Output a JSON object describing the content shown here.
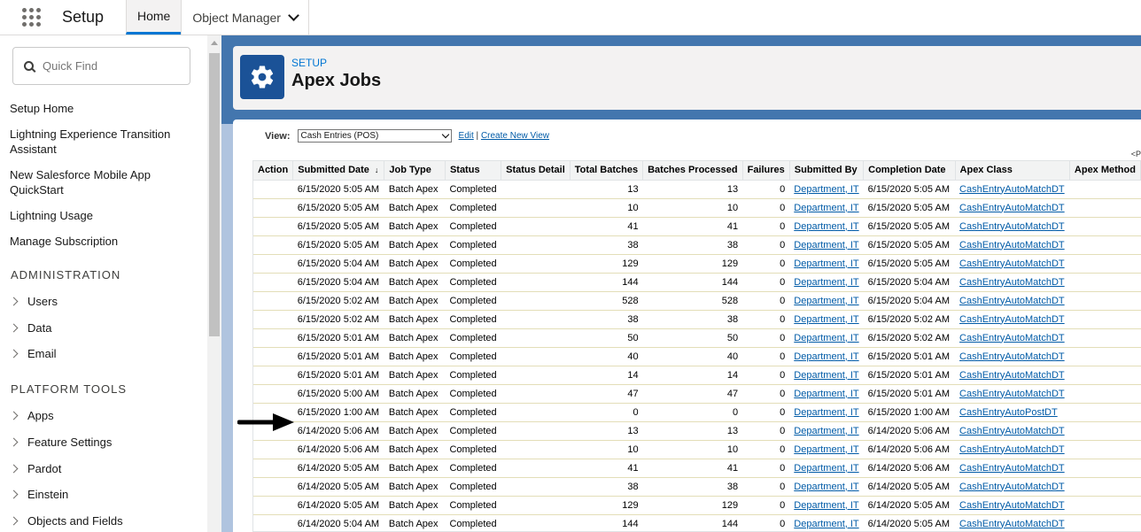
{
  "topbar": {
    "app_name": "Setup",
    "tabs": [
      {
        "label": "Home",
        "active": true
      },
      {
        "label": "Object Manager",
        "active": false
      }
    ]
  },
  "sidebar": {
    "quick_find_placeholder": "Quick Find",
    "links": [
      "Setup Home",
      "Lightning Experience Transition Assistant",
      "New Salesforce Mobile App QuickStart",
      "Lightning Usage",
      "Manage Subscription"
    ],
    "section_admin": "ADMINISTRATION",
    "admin_items": [
      "Users",
      "Data",
      "Email"
    ],
    "section_platform": "PLATFORM TOOLS",
    "platform_items": [
      "Apps",
      "Feature Settings",
      "Pardot",
      "Einstein",
      "Objects and Fields"
    ]
  },
  "header": {
    "eyebrow": "SETUP",
    "title": "Apex Jobs"
  },
  "view": {
    "label": "View:",
    "selected": "Cash Entries (POS)",
    "edit": "Edit",
    "separator": "|",
    "create": "Create New View",
    "pager_hint": "<P"
  },
  "table": {
    "columns": [
      "Action",
      "Submitted Date",
      "Job Type",
      "Status",
      "Status Detail",
      "Total Batches",
      "Batches Processed",
      "Failures",
      "Submitted By",
      "Completion Date",
      "Apex Class",
      "Apex Method"
    ],
    "sort_indicator": "↓",
    "rows": [
      [
        "",
        "6/15/2020 5:05 AM",
        "Batch Apex",
        "Completed",
        "",
        "13",
        "13",
        "0",
        "Department, IT",
        "6/15/2020 5:05 AM",
        "CashEntryAutoMatchDT",
        ""
      ],
      [
        "",
        "6/15/2020 5:05 AM",
        "Batch Apex",
        "Completed",
        "",
        "10",
        "10",
        "0",
        "Department, IT",
        "6/15/2020 5:05 AM",
        "CashEntryAutoMatchDT",
        ""
      ],
      [
        "",
        "6/15/2020 5:05 AM",
        "Batch Apex",
        "Completed",
        "",
        "41",
        "41",
        "0",
        "Department, IT",
        "6/15/2020 5:05 AM",
        "CashEntryAutoMatchDT",
        ""
      ],
      [
        "",
        "6/15/2020 5:05 AM",
        "Batch Apex",
        "Completed",
        "",
        "38",
        "38",
        "0",
        "Department, IT",
        "6/15/2020 5:05 AM",
        "CashEntryAutoMatchDT",
        ""
      ],
      [
        "",
        "6/15/2020 5:04 AM",
        "Batch Apex",
        "Completed",
        "",
        "129",
        "129",
        "0",
        "Department, IT",
        "6/15/2020 5:05 AM",
        "CashEntryAutoMatchDT",
        ""
      ],
      [
        "",
        "6/15/2020 5:04 AM",
        "Batch Apex",
        "Completed",
        "",
        "144",
        "144",
        "0",
        "Department, IT",
        "6/15/2020 5:04 AM",
        "CashEntryAutoMatchDT",
        ""
      ],
      [
        "",
        "6/15/2020 5:02 AM",
        "Batch Apex",
        "Completed",
        "",
        "528",
        "528",
        "0",
        "Department, IT",
        "6/15/2020 5:04 AM",
        "CashEntryAutoMatchDT",
        ""
      ],
      [
        "",
        "6/15/2020 5:02 AM",
        "Batch Apex",
        "Completed",
        "",
        "38",
        "38",
        "0",
        "Department, IT",
        "6/15/2020 5:02 AM",
        "CashEntryAutoMatchDT",
        ""
      ],
      [
        "",
        "6/15/2020 5:01 AM",
        "Batch Apex",
        "Completed",
        "",
        "50",
        "50",
        "0",
        "Department, IT",
        "6/15/2020 5:02 AM",
        "CashEntryAutoMatchDT",
        ""
      ],
      [
        "",
        "6/15/2020 5:01 AM",
        "Batch Apex",
        "Completed",
        "",
        "40",
        "40",
        "0",
        "Department, IT",
        "6/15/2020 5:01 AM",
        "CashEntryAutoMatchDT",
        ""
      ],
      [
        "",
        "6/15/2020 5:01 AM",
        "Batch Apex",
        "Completed",
        "",
        "14",
        "14",
        "0",
        "Department, IT",
        "6/15/2020 5:01 AM",
        "CashEntryAutoMatchDT",
        ""
      ],
      [
        "",
        "6/15/2020 5:00 AM",
        "Batch Apex",
        "Completed",
        "",
        "47",
        "47",
        "0",
        "Department, IT",
        "6/15/2020 5:01 AM",
        "CashEntryAutoMatchDT",
        ""
      ],
      [
        "",
        "6/15/2020 1:00 AM",
        "Batch Apex",
        "Completed",
        "",
        "0",
        "0",
        "0",
        "Department, IT",
        "6/15/2020 1:00 AM",
        "CashEntryAutoPostDT",
        ""
      ],
      [
        "",
        "6/14/2020 5:06 AM",
        "Batch Apex",
        "Completed",
        "",
        "13",
        "13",
        "0",
        "Department, IT",
        "6/14/2020 5:06 AM",
        "CashEntryAutoMatchDT",
        ""
      ],
      [
        "",
        "6/14/2020 5:06 AM",
        "Batch Apex",
        "Completed",
        "",
        "10",
        "10",
        "0",
        "Department, IT",
        "6/14/2020 5:06 AM",
        "CashEntryAutoMatchDT",
        ""
      ],
      [
        "",
        "6/14/2020 5:05 AM",
        "Batch Apex",
        "Completed",
        "",
        "41",
        "41",
        "0",
        "Department, IT",
        "6/14/2020 5:06 AM",
        "CashEntryAutoMatchDT",
        ""
      ],
      [
        "",
        "6/14/2020 5:05 AM",
        "Batch Apex",
        "Completed",
        "",
        "38",
        "38",
        "0",
        "Department, IT",
        "6/14/2020 5:05 AM",
        "CashEntryAutoMatchDT",
        ""
      ],
      [
        "",
        "6/14/2020 5:05 AM",
        "Batch Apex",
        "Completed",
        "",
        "129",
        "129",
        "0",
        "Department, IT",
        "6/14/2020 5:05 AM",
        "CashEntryAutoMatchDT",
        ""
      ],
      [
        "",
        "6/14/2020 5:04 AM",
        "Batch Apex",
        "Completed",
        "",
        "144",
        "144",
        "0",
        "Department, IT",
        "6/14/2020 5:05 AM",
        "CashEntryAutoMatchDT",
        ""
      ]
    ]
  },
  "colors": {
    "brand_blue": "#1b5297",
    "link_blue": "#015ba7",
    "active_tab_border": "#0176d3"
  }
}
